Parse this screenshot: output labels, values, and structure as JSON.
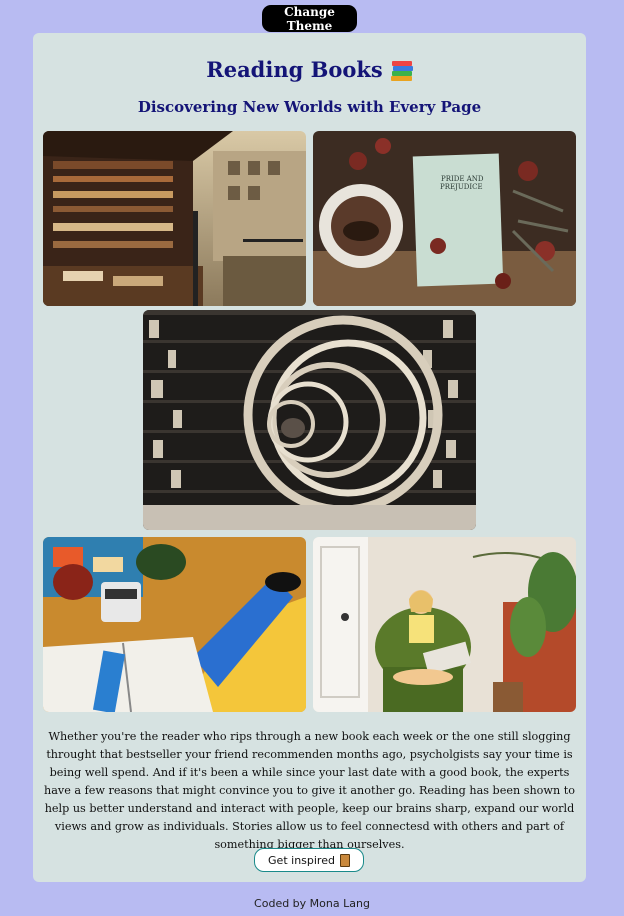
{
  "header": {
    "theme_button_label": "Change Theme"
  },
  "card": {
    "title": "Reading Books",
    "title_icon": "books-icon",
    "subtitle": "Discovering New Worlds with Every Page",
    "photos": [
      {
        "name": "street-bookstall-photo",
        "subject": "outdoor street bookstall"
      },
      {
        "name": "pride-and-prejudice-photo",
        "subject": "book with tea cup and dried roses",
        "book_title": "PRIDE AND PREJUDICE"
      },
      {
        "name": "circular-bookshelf-photo",
        "subject": "circular tunnel bookshelves"
      },
      {
        "name": "cozy-reading-photo",
        "subject": "open book, coffee mug and socks"
      },
      {
        "name": "child-reading-photo",
        "subject": "child reading in green armchair"
      }
    ],
    "body_text": "Whether you're the reader who rips through a new book each week or the one still slogging throught that bestseller your friend recommenden months ago, psycholgists say your time is being well spend. And if it's been a while since your last date with a good book, the experts have a few reasons that might convince you to give it another go. Reading has been shown to help us better understand and interact with people, keep our brains sharp, expand our world views and grow as individuals. Stories allow us to feel connectesd with others and part of something bigger than ourselves.",
    "inspire_button_label": "Get inspired",
    "inspire_button_icon": "book-icon"
  },
  "footer": {
    "credit": "Coded by Mona Lang"
  },
  "colors": {
    "page_bg": "#b8bbf2",
    "card_bg": "#d6e2e1",
    "heading": "#141477",
    "button_border": "#1a8a8a"
  }
}
